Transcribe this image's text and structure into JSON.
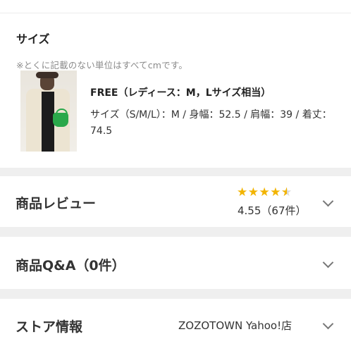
{
  "size": {
    "title": "サイズ",
    "note": "※とくに記載のない単位はすべてcmです。",
    "product": {
      "name": "FREE（レディース：M，Lサイズ相当）",
      "detail": "サイズ（S/M/L）：M / 身幅：52.5 / 肩幅：39 / 着丈：74.5"
    }
  },
  "review": {
    "title": "商品レビュー",
    "rating_value": 4.55,
    "rating_text": "4.55（67件）",
    "stars": [
      "★",
      "★",
      "★",
      "★"
    ],
    "half_star": "★"
  },
  "qa": {
    "title": "商品Q&A（0件）"
  },
  "store": {
    "title": "ストア情報",
    "name": "ZOZOTOWN Yahoo!店"
  },
  "colors": {
    "star": "#f2b400",
    "background_gap": "#efefef"
  },
  "icons": {
    "chevron": "chevron-down-icon"
  }
}
